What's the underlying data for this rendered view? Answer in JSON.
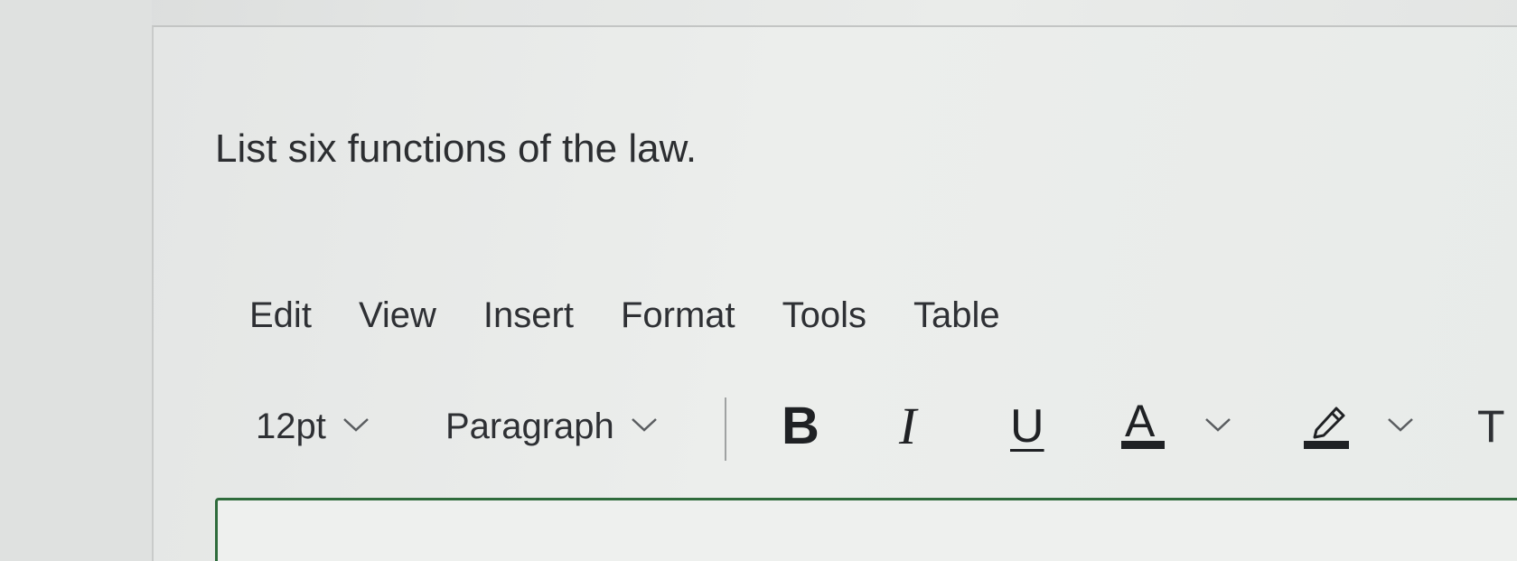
{
  "question": {
    "text": "List six functions of the law."
  },
  "menubar": {
    "items": [
      {
        "label": "Edit"
      },
      {
        "label": "View"
      },
      {
        "label": "Insert"
      },
      {
        "label": "Format"
      },
      {
        "label": "Tools"
      },
      {
        "label": "Table"
      }
    ]
  },
  "toolbar": {
    "font_size": "12pt",
    "block_format": "Paragraph",
    "bold_label": "B",
    "italic_label": "I",
    "underline_label": "U",
    "text_color_label": "A",
    "superscript_label": "T",
    "icons": {
      "dropdown": "chevron-down-icon",
      "highlight": "highlighter-icon"
    }
  },
  "colors": {
    "editor_border": "#2f6b3c",
    "text": "#2e3034"
  }
}
